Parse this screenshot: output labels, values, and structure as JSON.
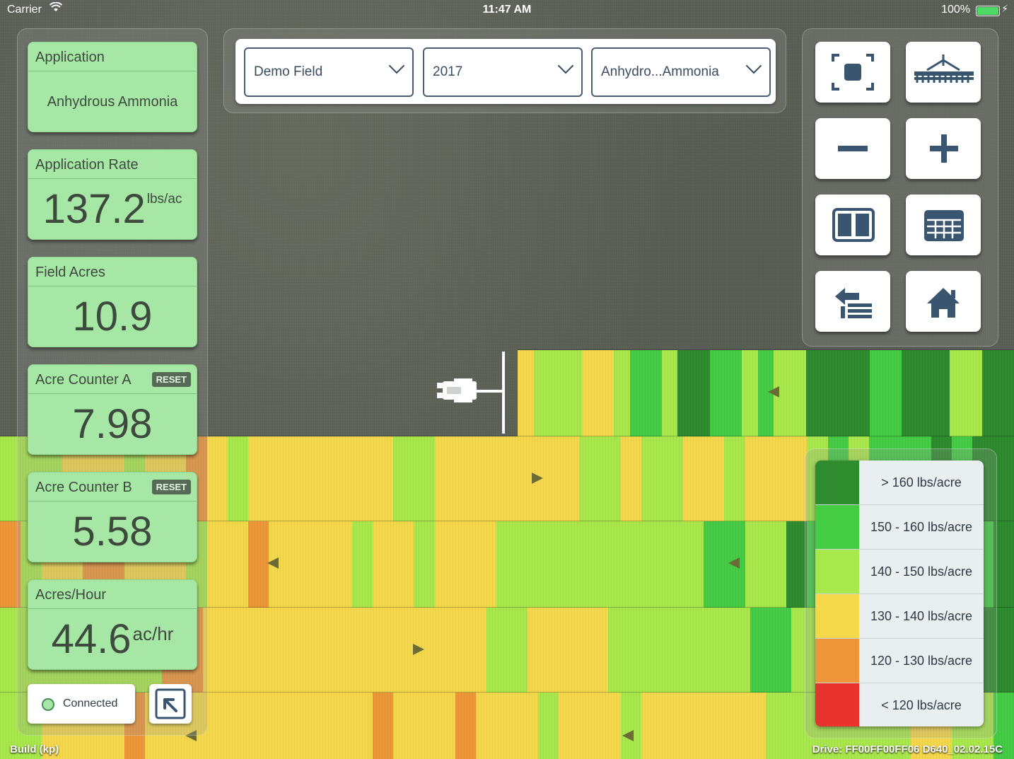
{
  "status_bar": {
    "carrier": "Carrier",
    "time": "11:47 AM",
    "battery": "100%",
    "battery_level": 1.0
  },
  "cards": {
    "application": {
      "title": "Application",
      "value": "Anhydrous Ammonia"
    },
    "application_rate": {
      "title": "Application Rate",
      "value": "137.2",
      "unit": "lbs/ac"
    },
    "field_acres": {
      "title": "Field Acres",
      "value": "10.9"
    },
    "acre_counter_a": {
      "title": "Acre Counter A",
      "reset": "RESET",
      "value": "7.98"
    },
    "acre_counter_b": {
      "title": "Acre Counter B",
      "reset": "RESET",
      "value": "5.58"
    },
    "acres_hour": {
      "title": "Acres/Hour",
      "value": "44.6",
      "unit": "ac/hr"
    }
  },
  "connection": {
    "label": "Connected"
  },
  "selectors": {
    "field": "Demo Field",
    "year": "2017",
    "product": "Anhydro...Ammonia"
  },
  "tools": [
    {
      "name": "fit-to-screen",
      "icon": "focus-frame-icon"
    },
    {
      "name": "implement",
      "icon": "implement-icon"
    },
    {
      "name": "zoom-out",
      "icon": "minus-icon"
    },
    {
      "name": "zoom-in",
      "icon": "plus-icon"
    },
    {
      "name": "split-view",
      "icon": "split-view-icon"
    },
    {
      "name": "table-view",
      "icon": "table-icon"
    },
    {
      "name": "import-list",
      "icon": "import-list-icon"
    },
    {
      "name": "home",
      "icon": "home-icon"
    }
  ],
  "legend": [
    {
      "label": "> 160 lbs/acre",
      "color": "#2e8b2e"
    },
    {
      "label": "150 - 160 lbs/acre",
      "color": "#44cc44"
    },
    {
      "label": "140 - 150 lbs/acre",
      "color": "#a8e84a"
    },
    {
      "label": "130 - 140 lbs/acre",
      "color": "#f5d84a"
    },
    {
      "label": "120 - 130 lbs/acre",
      "color": "#ee9638"
    },
    {
      "label": "< 120 lbs/acre",
      "color": "#e8322e"
    }
  ],
  "footer": {
    "build": "Build (kp)",
    "drive": "Drive: FF00FF00FF06 D640_02.02.15C"
  }
}
